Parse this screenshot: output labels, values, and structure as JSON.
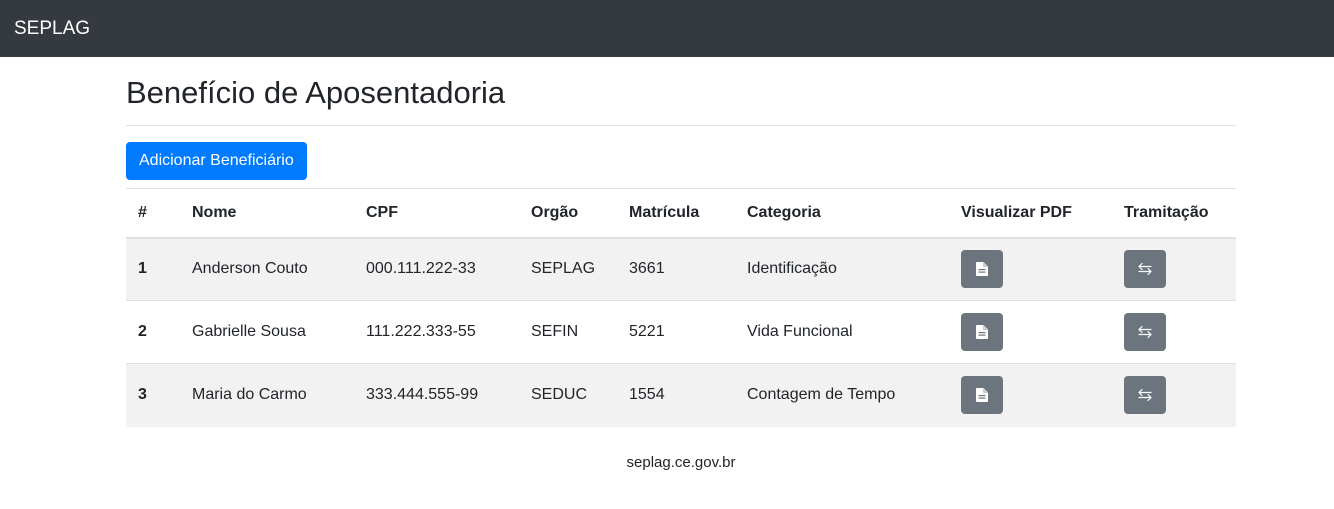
{
  "navbar": {
    "brand": "SEPLAG"
  },
  "page": {
    "title": "Benefício de Aposentadoria",
    "add_button": "Adicionar Beneficiário"
  },
  "table": {
    "headers": [
      "#",
      "Nome",
      "CPF",
      "Orgão",
      "Matrícula",
      "Categoria",
      "Visualizar PDF",
      "Tramitação"
    ],
    "rows": [
      {
        "index": "1",
        "nome": "Anderson Couto",
        "cpf": "000.111.222-33",
        "orgao": "SEPLAG",
        "matricula": "3661",
        "categoria": "Identificação"
      },
      {
        "index": "2",
        "nome": "Gabrielle Sousa",
        "cpf": "111.222.333-55",
        "orgao": "SEFIN",
        "matricula": "5221",
        "categoria": "Vida Funcional"
      },
      {
        "index": "3",
        "nome": "Maria do Carmo",
        "cpf": "333.444.555-99",
        "orgao": "SEDUC",
        "matricula": "1554",
        "categoria": "Contagem de Tempo"
      }
    ],
    "pdf_icon": "file-icon",
    "tramitacao_icon": "swap-arrows-icon"
  },
  "footer": {
    "text": "seplag.ce.gov.br"
  },
  "colors": {
    "navbar": "#343a40",
    "primary": "#007bff",
    "secondary": "#6c757d"
  }
}
